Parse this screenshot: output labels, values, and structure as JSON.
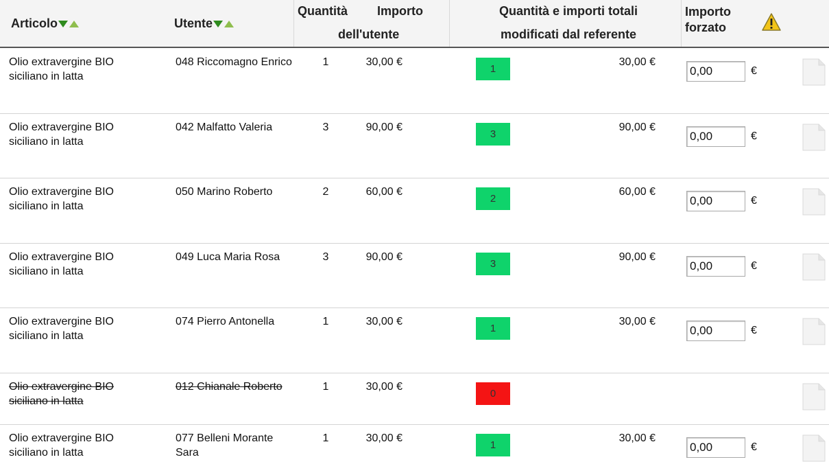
{
  "header": {
    "articolo": "Articolo",
    "utente": "Utente",
    "quantita": "Quantità",
    "importo": "Importo",
    "dellutente": "dell'utente",
    "totali_line1": "Quantità e importi totali",
    "totali_line2": "modificati dal referente",
    "forzato_line1": "Importo",
    "forzato_line2": "forzato"
  },
  "icons": {
    "sort_desc": "triangle-down-icon",
    "sort_asc": "triangle-up-icon",
    "warning": "warning-icon",
    "document": "document-icon"
  },
  "colors": {
    "badge_ok": "#0fd36b",
    "badge_zero": "#f41414"
  },
  "rows": [
    {
      "articolo": "Olio extravergine BIO siciliano in latta",
      "utente": "048 Riccomagno Enrico",
      "quantita": "1",
      "importo": "30,00 €",
      "qty_ref": "1",
      "totale": "30,00 €",
      "forzato": "0,00",
      "euro": "€",
      "status": "ok"
    },
    {
      "articolo": "Olio extravergine BIO siciliano in latta",
      "utente": "042 Malfatto Valeria",
      "quantita": "3",
      "importo": "90,00 €",
      "qty_ref": "3",
      "totale": "90,00 €",
      "forzato": "0,00",
      "euro": "€",
      "status": "ok"
    },
    {
      "articolo": "Olio extravergine BIO siciliano in latta",
      "utente": "050 Marino Roberto",
      "quantita": "2",
      "importo": "60,00 €",
      "qty_ref": "2",
      "totale": "60,00 €",
      "forzato": "0,00",
      "euro": "€",
      "status": "ok"
    },
    {
      "articolo": "Olio extravergine BIO siciliano in latta",
      "utente": "049 Luca Maria Rosa",
      "quantita": "3",
      "importo": "90,00 €",
      "qty_ref": "3",
      "totale": "90,00 €",
      "forzato": "0,00",
      "euro": "€",
      "status": "ok"
    },
    {
      "articolo": "Olio extravergine BIO siciliano in latta",
      "utente": "074 Pierro Antonella",
      "quantita": "1",
      "importo": "30,00 €",
      "qty_ref": "1",
      "totale": "30,00 €",
      "forzato": "0,00",
      "euro": "€",
      "status": "ok"
    },
    {
      "articolo": "Olio extravergine BIO siciliano in latta",
      "utente": "012 Chianale Roberto",
      "quantita": "1",
      "importo": "30,00 €",
      "qty_ref": "0",
      "totale": "",
      "forzato": "",
      "euro": "",
      "status": "cancelled"
    },
    {
      "articolo": "Olio extravergine BIO siciliano in latta",
      "utente": "077 Belleni Morante Sara",
      "quantita": "1",
      "importo": "30,00 €",
      "qty_ref": "1",
      "totale": "30,00 €",
      "forzato": "0,00",
      "euro": "€",
      "status": "ok"
    }
  ]
}
